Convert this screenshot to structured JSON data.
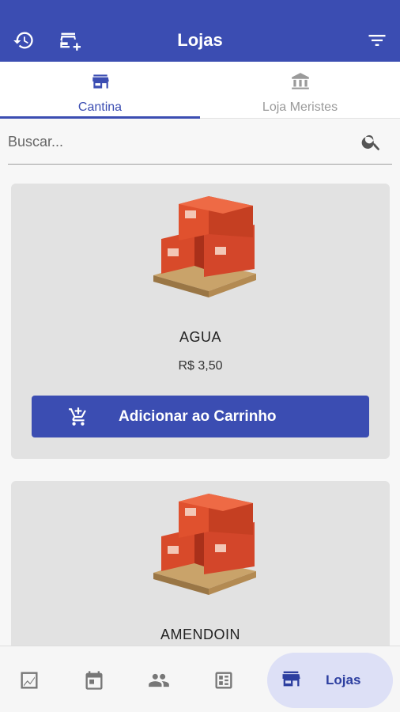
{
  "appbar": {
    "title": "Lojas",
    "icons": [
      "history-icon",
      "add-store-icon",
      "filter-icon"
    ]
  },
  "tabs": [
    {
      "label": "Cantina",
      "icon": "store-icon",
      "active": true
    },
    {
      "label": "Loja Meristes",
      "icon": "bank-icon",
      "active": false
    }
  ],
  "search": {
    "placeholder": "Buscar...",
    "value": ""
  },
  "products": [
    {
      "name": "AGUA",
      "price": "R$ 3,50",
      "button_label": "Adicionar ao Carrinho",
      "image": "boxes-on-pallet"
    },
    {
      "name": "AMENDOIN",
      "image": "boxes-on-pallet"
    }
  ],
  "bottom_nav": {
    "items": [
      "dashboard-icon",
      "calendar-icon",
      "people-icon",
      "receipt-icon"
    ],
    "active": {
      "label": "Lojas",
      "icon": "store-icon"
    }
  },
  "colors": {
    "primary": "#3b4db2",
    "card": "#e2e2e2",
    "nav_active_bg": "#dde0f6"
  }
}
